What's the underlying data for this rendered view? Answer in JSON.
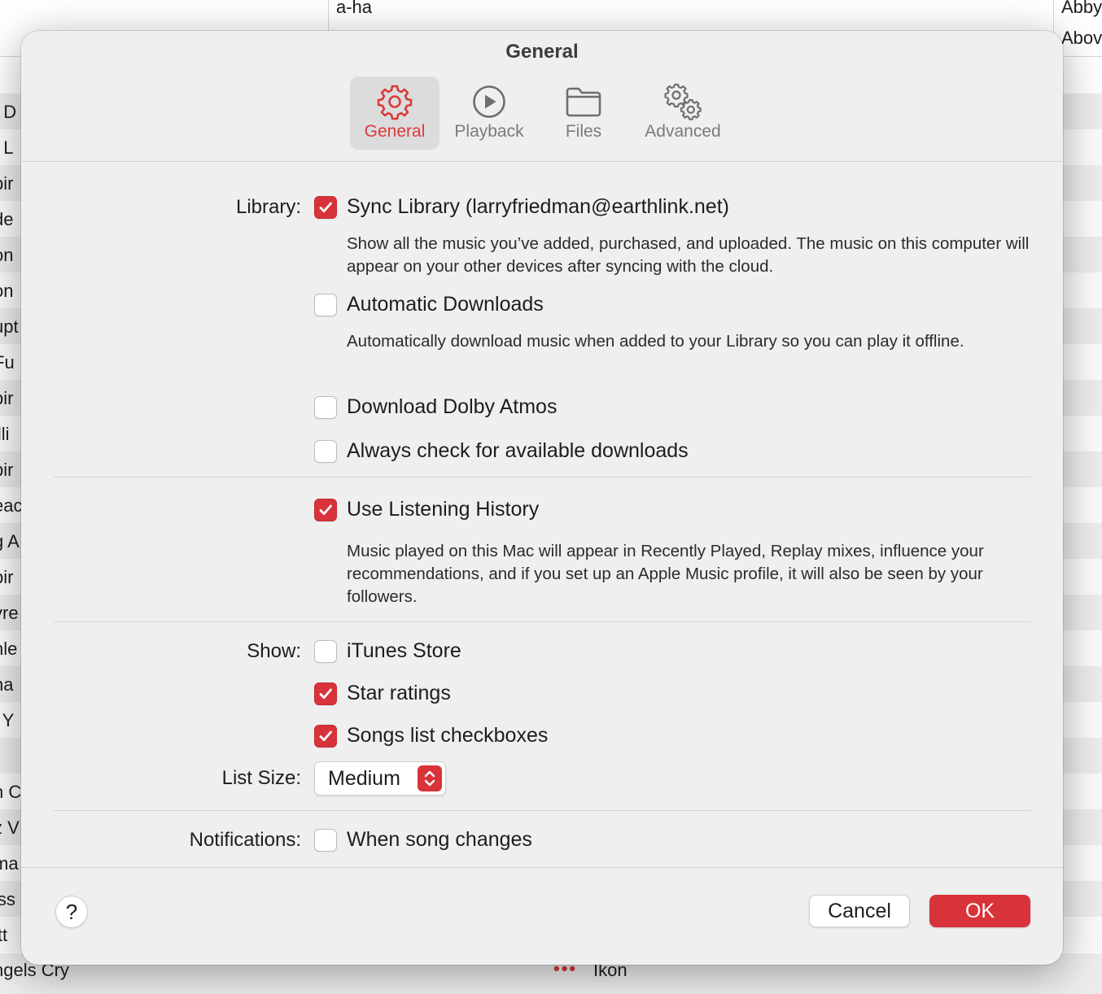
{
  "background": {
    "header": {
      "artist": "a-ha",
      "album_rows": [
        "Abby",
        "Abov"
      ]
    },
    "rows": [
      "t D",
      "/ L",
      "pir",
      "de",
      "on",
      "on",
      "upt",
      "Fu",
      "pir",
      "illi",
      "pir",
      "eac",
      "g A",
      "pir",
      "yre",
      "nle",
      "na",
      "l Y",
      "",
      "n C",
      "z V",
      "ma",
      "iss",
      "itt"
    ],
    "footer": {
      "song": "ngels Cry",
      "more": "•••",
      "album": "Ikon"
    }
  },
  "dialog": {
    "title": "General",
    "tabs": [
      {
        "label": "General",
        "icon": "gear-icon",
        "selected": true
      },
      {
        "label": "Playback",
        "icon": "play-circle-icon",
        "selected": false
      },
      {
        "label": "Files",
        "icon": "folder-icon",
        "selected": false
      },
      {
        "label": "Advanced",
        "icon": "gears-icon",
        "selected": false
      }
    ],
    "library": {
      "label": "Library:",
      "sync_library": {
        "label": "Sync Library (larryfriedman@earthlink.net)",
        "checked": true
      },
      "sync_desc": "Show all the music you’ve added, purchased, and uploaded. The music on this computer will appear on your other devices after syncing with the cloud.",
      "automatic_downloads": {
        "label": "Automatic Downloads",
        "checked": false
      },
      "auto_desc": "Automatically download music when added to your Library so you can play it offline.",
      "dolby_atmos": {
        "label": "Download Dolby Atmos",
        "checked": false
      },
      "always_check": {
        "label": "Always check for available downloads",
        "checked": false
      }
    },
    "history": {
      "use_listening_history": {
        "label": "Use Listening History",
        "checked": true
      },
      "desc": "Music played on this Mac will appear in Recently Played, Replay mixes, influence your recommendations, and if you set up an Apple Music profile, it will also be seen by your followers."
    },
    "show": {
      "label": "Show:",
      "itunes_store": {
        "label": "iTunes Store",
        "checked": false
      },
      "star_ratings": {
        "label": "Star ratings",
        "checked": true
      },
      "songs_checkboxes": {
        "label": "Songs list checkboxes",
        "checked": true
      }
    },
    "list_size": {
      "label": "List Size:",
      "value": "Medium"
    },
    "notifications": {
      "label": "Notifications:",
      "song_changes": {
        "label": "When song changes",
        "checked": false
      }
    },
    "buttons": {
      "help": "?",
      "cancel": "Cancel",
      "ok": "OK"
    },
    "accent_color": "#d8333a"
  }
}
